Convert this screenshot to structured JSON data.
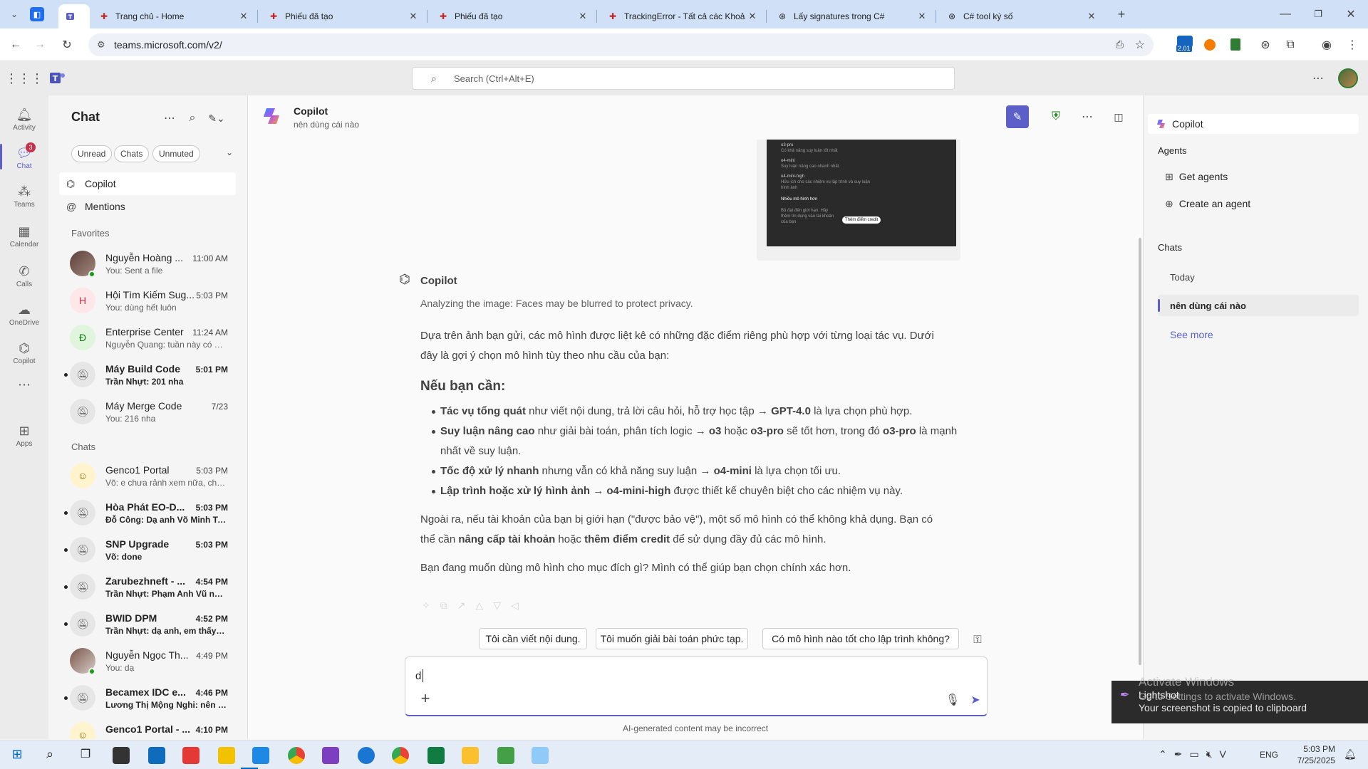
{
  "browser": {
    "tabs": [
      {
        "title": "Trang chủ - Home"
      },
      {
        "title": "Phiếu đã tạo"
      },
      {
        "title": "Phiếu đã tạo"
      },
      {
        "title": "TrackingError - Tất cả các Khoả"
      },
      {
        "title": "Lấy signatures trong C#"
      },
      {
        "title": "C# tool ký số"
      }
    ],
    "url": "teams.microsoft.com/v2/",
    "extension_badge": "2.01"
  },
  "teams": {
    "search_placeholder": "Search (Ctrl+Alt+E)",
    "rail": [
      {
        "label": "Activity",
        "icon": "bell-icon"
      },
      {
        "label": "Chat",
        "icon": "chat-icon",
        "badge": "3"
      },
      {
        "label": "Teams",
        "icon": "teams-icon"
      },
      {
        "label": "Calendar",
        "icon": "calendar-icon"
      },
      {
        "label": "Calls",
        "icon": "phone-icon"
      },
      {
        "label": "OneDrive",
        "icon": "cloud-icon"
      },
      {
        "label": "Copilot",
        "icon": "copilot-icon"
      },
      {
        "label": "Apps",
        "icon": "apps-icon"
      }
    ]
  },
  "chatlist": {
    "title": "Chat",
    "filters": [
      "Unread",
      "Chats",
      "Unmuted"
    ],
    "nav": [
      {
        "label": "Copilot"
      },
      {
        "label": "Mentions"
      }
    ],
    "favorites_title": "Favorites",
    "chats_title": "Chats",
    "favorites": [
      {
        "name": "Nguyễn Hoàng ...",
        "time": "11:00 AM",
        "preview": "You: Sent a file",
        "bold": false
      },
      {
        "name": "Hội Tìm Kiếm Sug...",
        "time": "5:03 PM",
        "preview": "You: dùng hết luôn",
        "bold": false
      },
      {
        "name": "Enterprise Center",
        "time": "11:24 AM",
        "preview": "Nguyễn Quang: tuần này có 2 ...",
        "bold": false
      },
      {
        "name": "Máy Build Code",
        "time": "5:01 PM",
        "preview": "Trần Nhựt: 201 nha",
        "bold": true
      },
      {
        "name": "Máy Merge Code",
        "time": "7/23",
        "preview": "You: 216  nha",
        "bold": false
      }
    ],
    "chats": [
      {
        "name": "Genco1 Portal",
        "time": "5:03 PM",
        "preview": "Võ: e chưa rảnh xem nữa, chắc...",
        "bold": false
      },
      {
        "name": "Hòa Phát EO-D...",
        "time": "5:03 PM",
        "preview": "Đỗ Công: Dạ anh Võ Minh Tu...",
        "bold": true
      },
      {
        "name": "SNP Upgrade",
        "time": "5:03 PM",
        "preview": "Võ: done",
        "bold": true
      },
      {
        "name": "Zarubezhneft - ...",
        "time": "4:54 PM",
        "preview": "Trần Nhựt: Phạm Anh Vũ nhớ...",
        "bold": true
      },
      {
        "name": "BWID DPM",
        "time": "4:52 PM",
        "preview": "Trần Nhựt: dạ anh, em thấy lê...",
        "bold": true
      },
      {
        "name": "Nguyễn Ngọc Th...",
        "time": "4:49 PM",
        "preview": "You: dạ",
        "bold": false
      },
      {
        "name": "Becamex IDC e...",
        "time": "4:46 PM",
        "preview": "Lương Thị Mộng Nghi: nên 17...",
        "bold": true
      },
      {
        "name": "Genco1 Portal - ...",
        "time": "4:10 PM",
        "preview": "",
        "bold": true
      }
    ]
  },
  "conversation": {
    "title": "Copilot",
    "subtitle": "nên dùng cái nào",
    "image_lines": [
      "o3-pro",
      "Có khả năng suy luận tốt nhất",
      "o4-mini",
      "Suy luận nâng cao nhanh nhất",
      "o4-mini-high",
      "Hữu ích cho các nhiệm vụ lập trình và suy luận hình ảnh",
      "Nhiều mô hình hơn",
      "Bộ đạt đến giới hạn. Hãy thêm tín dụng vào tài khoản của bạn",
      "Thêm điểm credit"
    ],
    "sender": "Copilot",
    "analyzing": "Analyzing the image: Faces may be blurred to protect privacy.",
    "intro": "Dựa trên ảnh bạn gửi, các mô hình được liệt kê có những đặc điểm riêng phù hợp với từng loại tác vụ. Dưới đây là gợi ý chọn mô hình tùy theo nhu cầu của bạn:",
    "heading": "Nếu bạn cần:",
    "bullets": [
      {
        "b1": "Tác vụ tổng quát",
        "t1": " như viết nội dung, trả lời câu hỏi, hỗ trợ học tập → ",
        "b2": "GPT-4.0",
        "t2": " là lựa chọn phù hợp."
      },
      {
        "b1": "Suy luận nâng cao",
        "t1": " như giải bài toán, phân tích logic → ",
        "b2": "o3",
        "t2": " hoặc ",
        "b3": "o3-pro",
        "t3": " sẽ tốt hơn, trong đó ",
        "b4": "o3-pro",
        "t4": " là mạnh nhất về suy luận."
      },
      {
        "b1": "Tốc độ xử lý nhanh",
        "t1": " nhưng vẫn có khả năng suy luận → ",
        "b2": "o4-mini",
        "t2": " là lựa chọn tối ưu."
      },
      {
        "b1": "Lập trình hoặc xử lý hình ảnh → o4-mini-high",
        "t1": " được thiết kế chuyên biệt cho các nhiệm vụ này."
      }
    ],
    "para2_a": "Ngoài ra, nếu tài khoản của bạn bị giới hạn (\"được bảo vệ\"), một số mô hình có thể không khả dụng. Bạn có thể cần ",
    "para2_b1": "nâng cấp tài khoản",
    "para2_c": " hoặc ",
    "para2_b2": "thêm điểm credit",
    "para2_d": " để sử dụng đầy đủ các mô hình.",
    "para3": "Bạn đang muốn dùng mô hình cho mục đích gì? Mình có thể giúp bạn chọn chính xác hơn.",
    "suggestions": [
      "Tôi cần viết nội dung.",
      "Tôi muốn giải bài toán phức tạp.",
      "Có mô hình nào tốt cho lập trình không?"
    ],
    "composer_value": "d",
    "disclaimer": "AI-generated content may be incorrect"
  },
  "right_pane": {
    "title": "Copilot",
    "agents_title": "Agents",
    "get_agents": "Get agents",
    "create_agent": "Create an agent",
    "chats_title": "Chats",
    "today": "Today",
    "active_chat": "nên dùng cái nào",
    "see_more": "See more"
  },
  "notifications": {
    "watermark_title": "Activate Windows",
    "watermark_sub": "Go to Settings to activate Windows.",
    "toast_title": "Lightshot",
    "toast_body": "Your screenshot is copied to clipboard"
  },
  "taskbar": {
    "lang": "ENG",
    "time": "5:03 PM",
    "date": "7/25/2025"
  },
  "colors": {
    "accent": "#5b5fc7",
    "browser_tabbar": "#cfe0f7"
  }
}
